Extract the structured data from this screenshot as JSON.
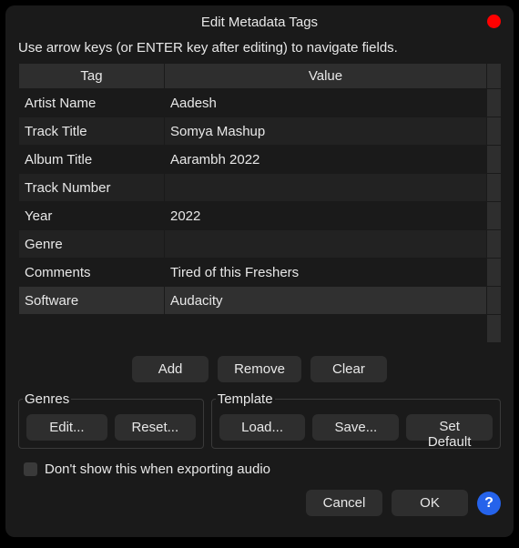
{
  "title": "Edit Metadata Tags",
  "instruction": "Use arrow keys (or ENTER key after editing) to navigate fields.",
  "headers": {
    "tag": "Tag",
    "value": "Value"
  },
  "rows": [
    {
      "tag": "Artist Name",
      "value": "Aadesh"
    },
    {
      "tag": "Track Title",
      "value": "Somya Mashup"
    },
    {
      "tag": "Album Title",
      "value": "Aarambh 2022"
    },
    {
      "tag": "Track Number",
      "value": ""
    },
    {
      "tag": "Year",
      "value": "2022"
    },
    {
      "tag": "Genre",
      "value": ""
    },
    {
      "tag": "Comments",
      "value": "Tired of this Freshers"
    },
    {
      "tag": "Software",
      "value": "Audacity"
    },
    {
      "tag": "",
      "value": ""
    }
  ],
  "buttons": {
    "add": "Add",
    "remove": "Remove",
    "clear": "Clear",
    "edit": "Edit...",
    "reset": "Reset...",
    "load": "Load...",
    "save": "Save...",
    "setdefault": "Set Default",
    "cancel": "Cancel",
    "ok": "OK",
    "help": "?"
  },
  "sections": {
    "genres": "Genres",
    "template": "Template"
  },
  "checkbox": {
    "label": "Don't show this when exporting audio"
  }
}
